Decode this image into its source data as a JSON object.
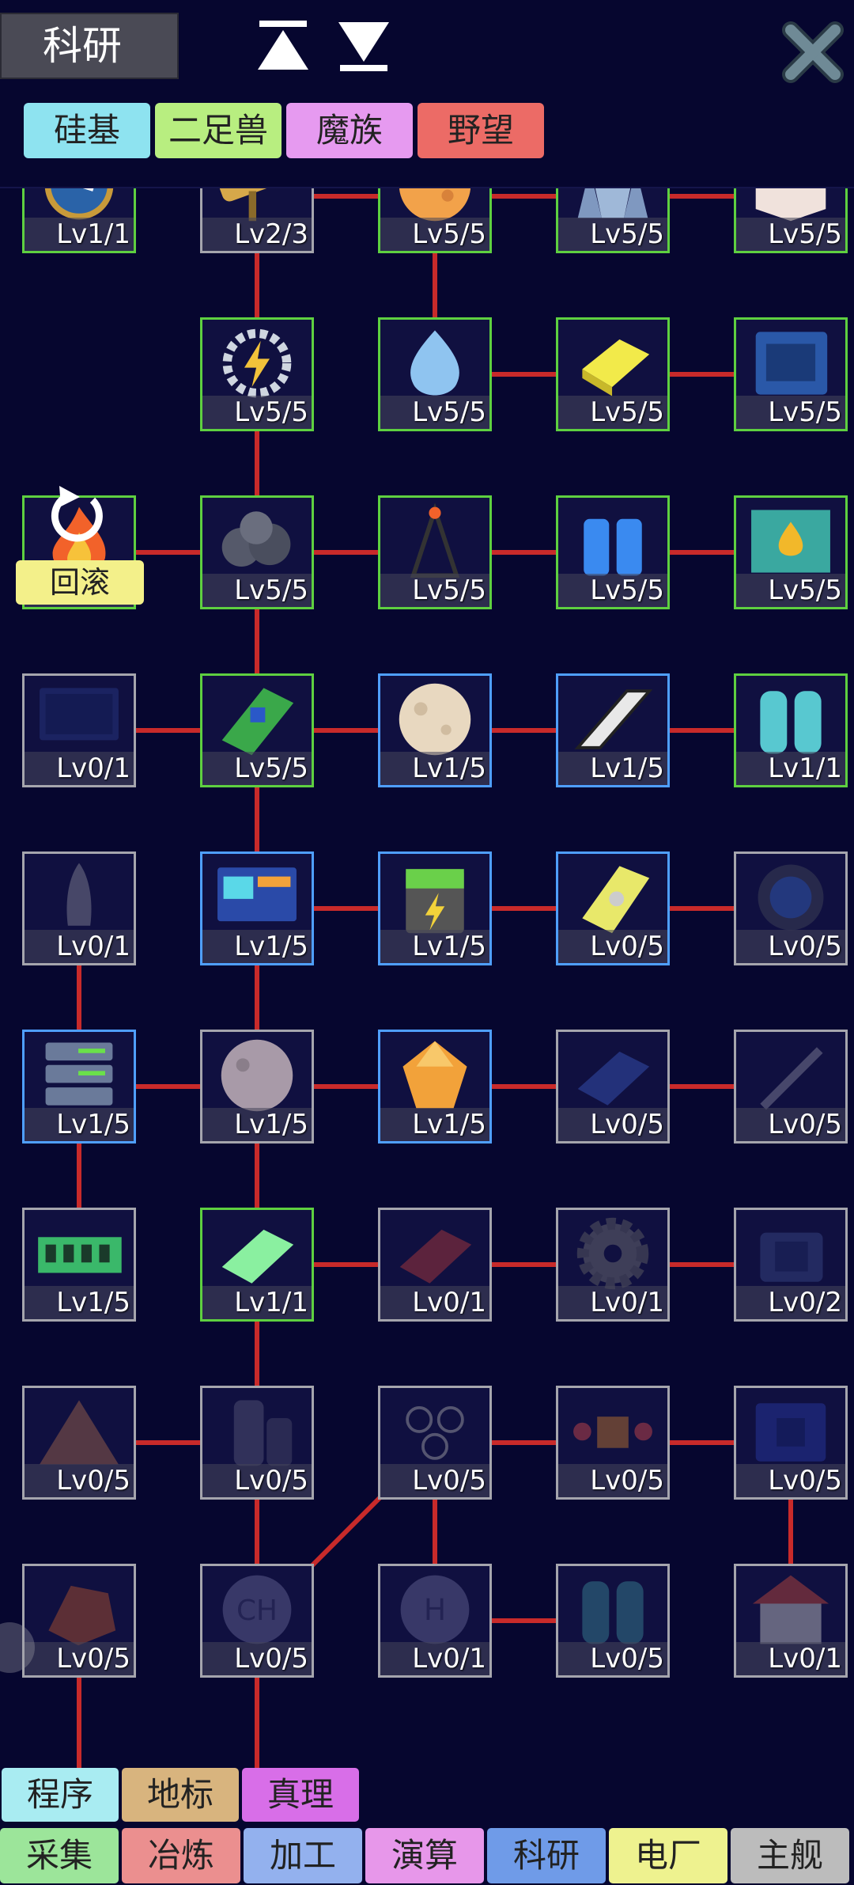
{
  "header": {
    "title": "科研",
    "filter_tabs": [
      {
        "label": "硅基",
        "color": "#8ee3f0"
      },
      {
        "label": "二足兽",
        "color": "#b8ee80"
      },
      {
        "label": "魔族",
        "color": "#e69af0"
      },
      {
        "label": "野望",
        "color": "#ec6b66"
      }
    ]
  },
  "rollback": {
    "label": "回滚"
  },
  "nodes": [
    {
      "icon": "clock-icon",
      "level": "Lv1/1",
      "state": "green"
    },
    {
      "icon": "telescope-icon",
      "level": "Lv2/3",
      "state": "gray"
    },
    {
      "icon": "orange-planet-icon",
      "level": "Lv5/5",
      "state": "green"
    },
    {
      "icon": "crystal-icon",
      "level": "Lv5/5",
      "state": "green"
    },
    {
      "icon": "white-cube-icon",
      "level": "Lv5/5",
      "state": "green"
    },
    {
      "icon": "power-gear-icon",
      "level": "Lv5/5",
      "state": "green"
    },
    {
      "icon": "water-splash-icon",
      "level": "Lv5/5",
      "state": "green"
    },
    {
      "icon": "gold-ingot-icon",
      "level": "Lv5/5",
      "state": "green"
    },
    {
      "icon": "circuit-board-icon",
      "level": "Lv5/5",
      "state": "green"
    },
    {
      "icon": "fire-icon",
      "level": "Lv5/5",
      "state": "green"
    },
    {
      "icon": "coal-icon",
      "level": "Lv5/5",
      "state": "green"
    },
    {
      "icon": "oil-derrick-icon",
      "level": "Lv5/5",
      "state": "green"
    },
    {
      "icon": "water-bottles-icon",
      "level": "Lv5/5",
      "state": "green"
    },
    {
      "icon": "oil-tank-icon",
      "level": "Lv5/5",
      "state": "green"
    },
    {
      "icon": "monitor-icon",
      "level": "Lv0/1",
      "state": "gray"
    },
    {
      "icon": "chip-board-icon",
      "level": "Lv5/5",
      "state": "green"
    },
    {
      "icon": "moon-icon",
      "level": "Lv1/5",
      "state": "blue"
    },
    {
      "icon": "steel-beam-icon",
      "level": "Lv1/5",
      "state": "blue"
    },
    {
      "icon": "gas-cylinders-icon",
      "level": "Lv1/1",
      "state": "green"
    },
    {
      "icon": "rocket-icon",
      "level": "Lv0/1",
      "state": "gray"
    },
    {
      "icon": "computer-icon",
      "level": "Lv1/5",
      "state": "blue"
    },
    {
      "icon": "battery-icon",
      "level": "Lv1/5",
      "state": "blue"
    },
    {
      "icon": "hard-drive-icon",
      "level": "Lv0/5",
      "state": "blue"
    },
    {
      "icon": "lens-icon",
      "level": "Lv0/5",
      "state": "gray"
    },
    {
      "icon": "server-icon",
      "level": "Lv1/5",
      "state": "blue"
    },
    {
      "icon": "gray-moon-icon",
      "level": "Lv1/5",
      "state": "gray"
    },
    {
      "icon": "amber-gem-icon",
      "level": "Lv1/5",
      "state": "blue"
    },
    {
      "icon": "titanium-ingot-icon",
      "level": "Lv0/5",
      "state": "gray"
    },
    {
      "icon": "missile-icon",
      "level": "Lv0/5",
      "state": "gray"
    },
    {
      "icon": "ram-stick-icon",
      "level": "Lv1/5",
      "state": "gray"
    },
    {
      "icon": "silicon-ingot-icon",
      "level": "Lv1/1",
      "state": "green"
    },
    {
      "icon": "copper-ingot-icon",
      "level": "Lv0/1",
      "state": "gray"
    },
    {
      "icon": "cog-icon",
      "level": "Lv0/1",
      "state": "gray"
    },
    {
      "icon": "generator-icon",
      "level": "Lv0/2",
      "state": "gray"
    },
    {
      "icon": "pyramid-icon",
      "level": "Lv0/5",
      "state": "gray"
    },
    {
      "icon": "moai-icon",
      "level": "Lv0/5",
      "state": "gray"
    },
    {
      "icon": "molecule-icon",
      "level": "Lv0/5",
      "state": "gray"
    },
    {
      "icon": "chip-signal-icon",
      "level": "Lv0/5",
      "state": "gray"
    },
    {
      "icon": "processor-icon",
      "level": "Lv0/5",
      "state": "gray"
    },
    {
      "icon": "red-ore-icon",
      "level": "Lv0/5",
      "state": "gray"
    },
    {
      "icon": "methane-icon",
      "level": "Lv0/5",
      "state": "gray"
    },
    {
      "icon": "hydrogen-icon",
      "level": "Lv0/1",
      "state": "gray"
    },
    {
      "icon": "dual-tanks-icon",
      "level": "Lv0/5",
      "state": "gray"
    },
    {
      "icon": "data-house-icon",
      "level": "Lv0/1",
      "state": "gray"
    }
  ],
  "sub_tabs": [
    {
      "label": "程序",
      "color": "#a9ecf2"
    },
    {
      "label": "地标",
      "color": "#d8b47e"
    },
    {
      "label": "真理",
      "color": "#d86ee8"
    }
  ],
  "main_tabs": [
    {
      "label": "采集",
      "color": "#9ce59a"
    },
    {
      "label": "冶炼",
      "color": "#eb8f8f"
    },
    {
      "label": "加工",
      "color": "#93b1ee"
    },
    {
      "label": "演算",
      "color": "#e797ea"
    },
    {
      "label": "科研",
      "color": "#6f9be8"
    },
    {
      "label": "电厂",
      "color": "#eef28f"
    },
    {
      "label": "主舰",
      "color": "#bcbcbc"
    }
  ]
}
